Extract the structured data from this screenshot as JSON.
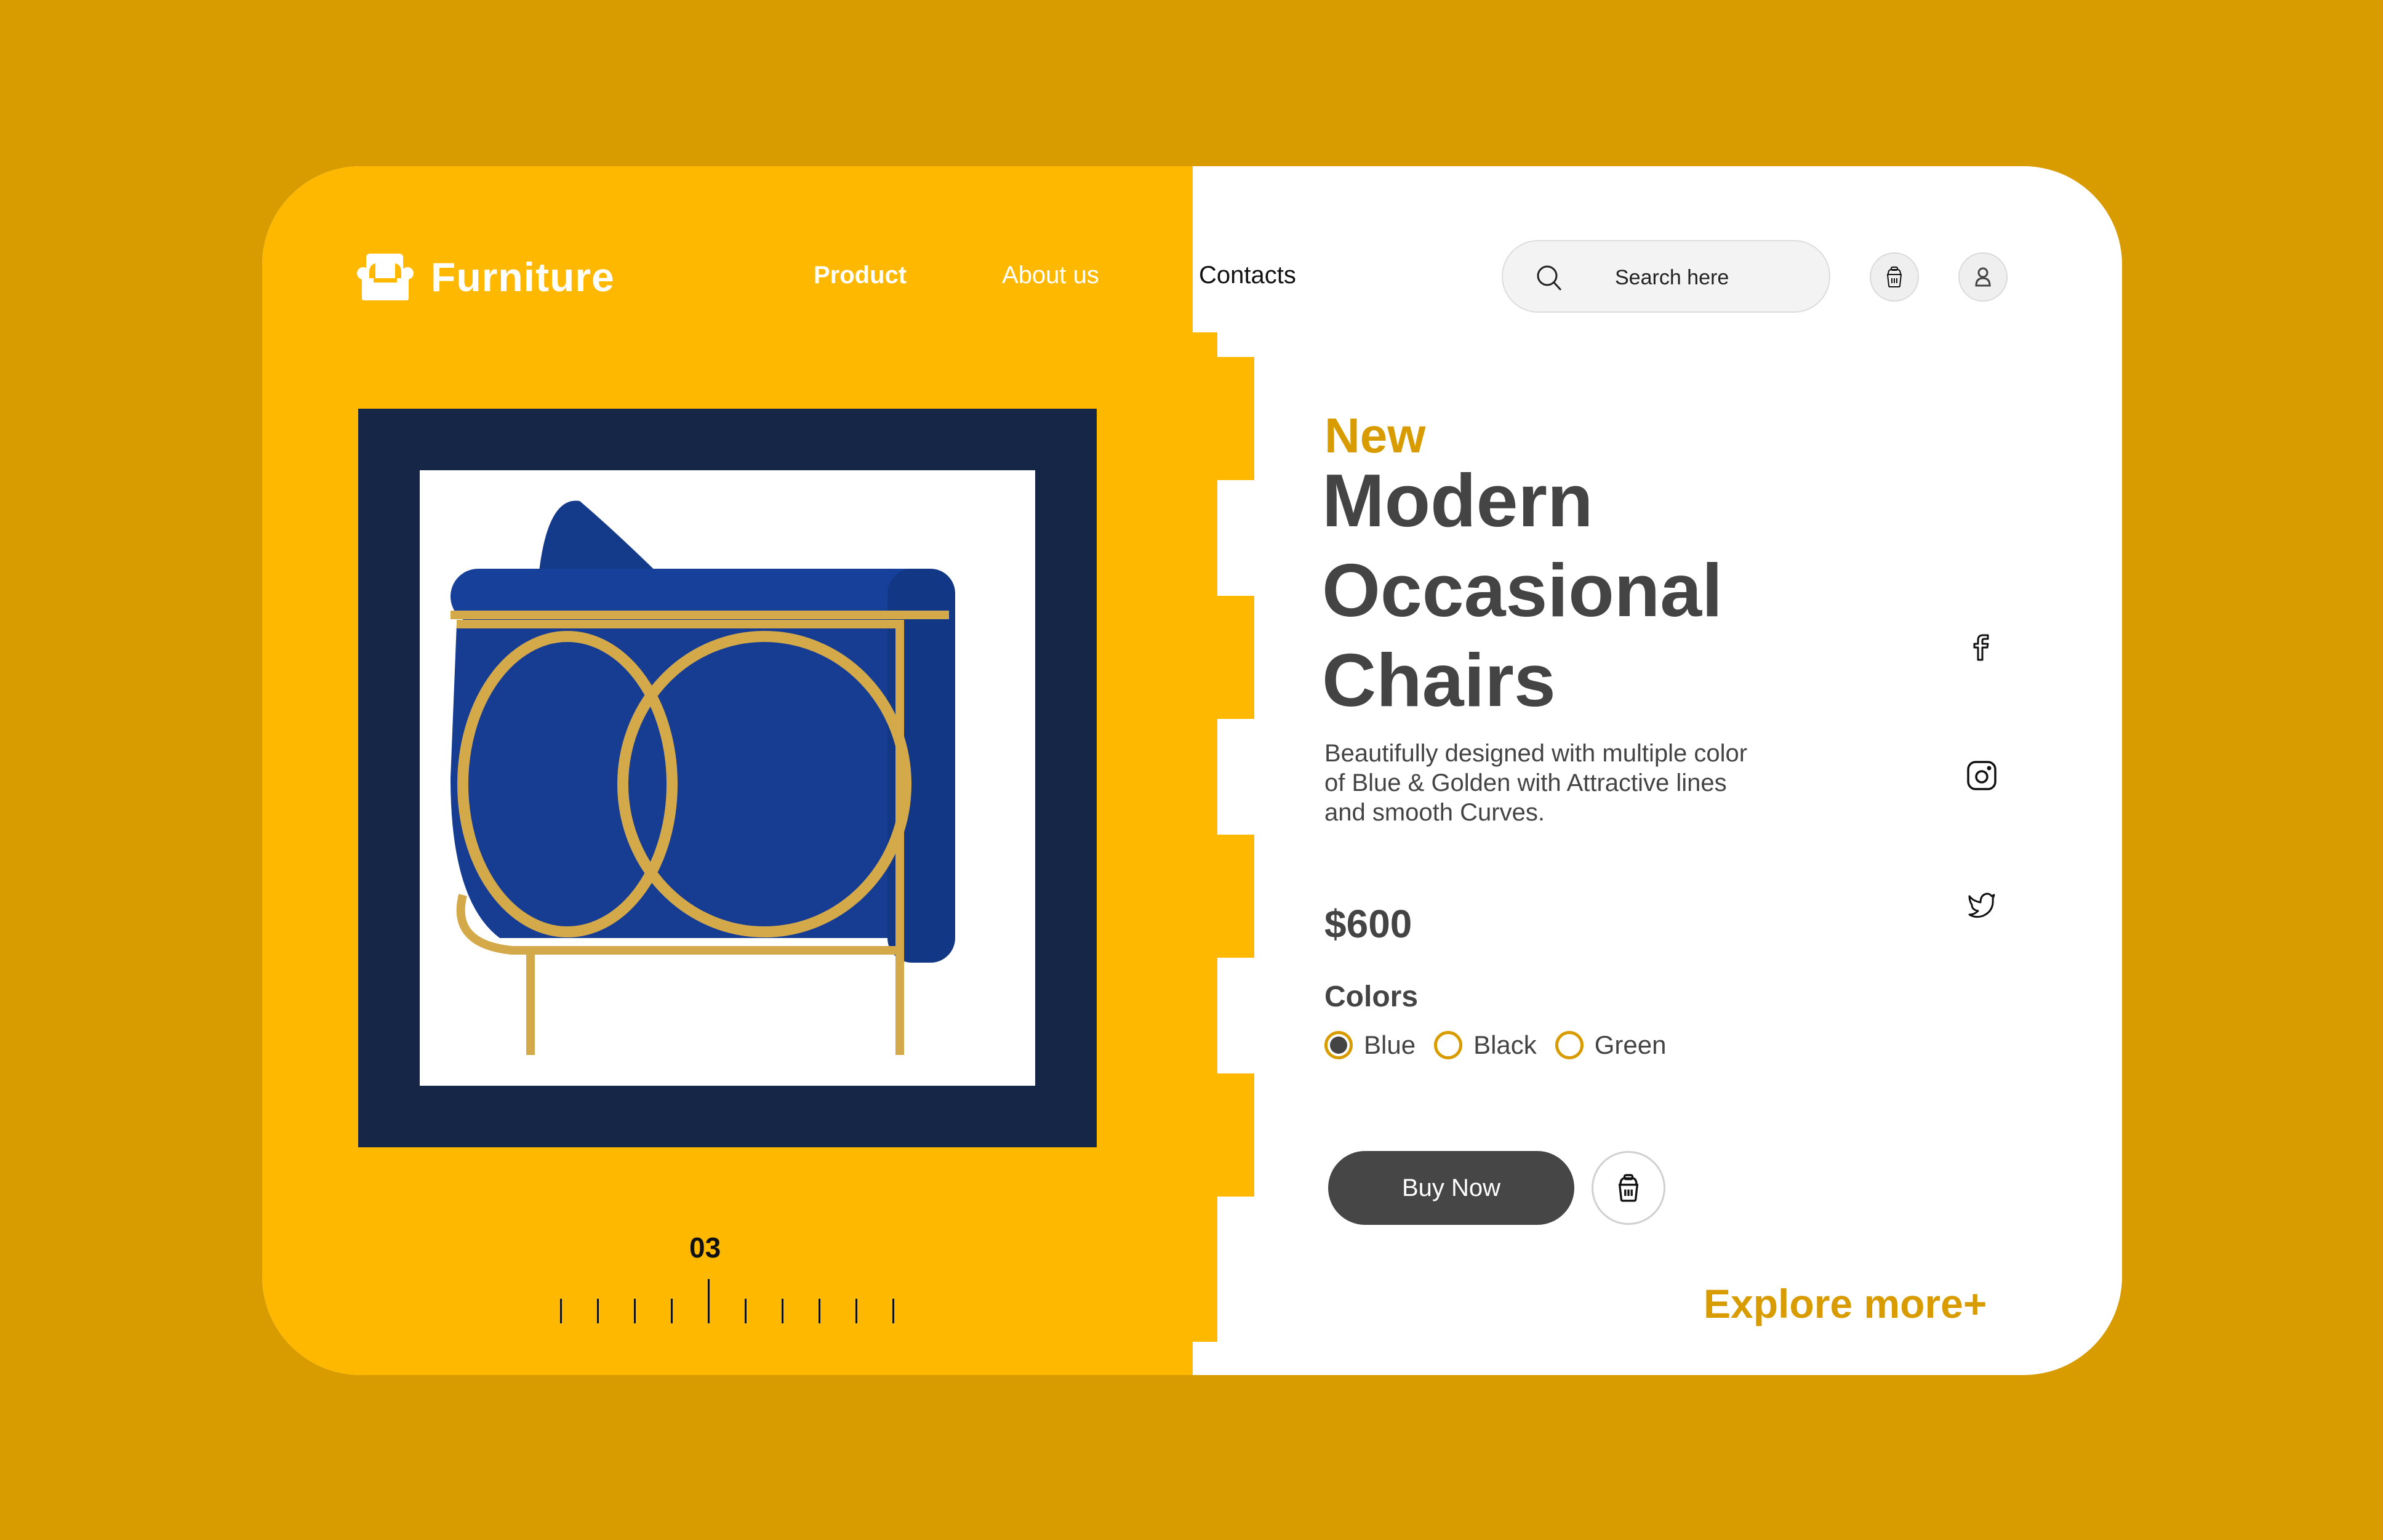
{
  "brand": {
    "name": "Furniture",
    "icon": "armchair-icon"
  },
  "nav": {
    "items": [
      {
        "label": "Product",
        "active": true
      },
      {
        "label": "About us",
        "active": false
      },
      {
        "label": "Contacts",
        "active": false
      }
    ]
  },
  "search": {
    "placeholder": "Search here",
    "value": "",
    "icon": "search-icon"
  },
  "header_actions": {
    "cart_icon": "basket-icon",
    "profile_icon": "user-icon"
  },
  "gallery": {
    "current_slide": "03",
    "total_ticks": 10,
    "active_tick_index": 4
  },
  "product": {
    "tag": "New",
    "title_lines": [
      "Modern",
      "Occasional",
      "Chairs"
    ],
    "description": "Beautifully designed with multiple color of Blue & Golden with Attractive lines and smooth Curves.",
    "price": "$600",
    "colors_label": "Colors",
    "colors": [
      {
        "label": "Blue",
        "selected": true
      },
      {
        "label": "Black",
        "selected": false
      },
      {
        "label": "Green",
        "selected": false
      }
    ],
    "buy_label": "Buy Now",
    "add_to_cart_icon": "basket-icon"
  },
  "social": [
    "facebook-icon",
    "instagram-icon",
    "twitter-icon"
  ],
  "explore_label": "Explore more+",
  "theme": {
    "background": "#D89C00",
    "panel_yellow": "#FFB800",
    "accent_gold": "#D89C00",
    "frame_navy": "#152646",
    "text_dark": "#444444"
  }
}
